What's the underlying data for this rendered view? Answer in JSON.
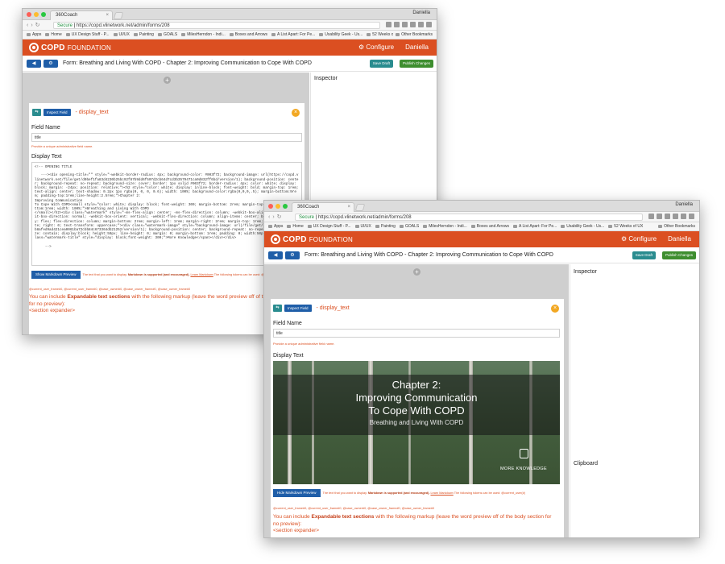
{
  "browser": {
    "tab_title": "360Coach",
    "user": "Daniella",
    "secure_label": "Secure",
    "url": "https://copd.vlinetwork.net/admin/forms/208",
    "bookmarks": [
      "Apps",
      "Home",
      "UX Design Stuff - P...",
      "UI/UX",
      "Painting",
      "GOALS",
      "MilesHerndon - Indi...",
      "Boxes and Arrows",
      "A List Apart: For Pe...",
      "Usability Geek - Us...",
      "52 Weeks of UX"
    ],
    "other_bookmarks": "Other Bookmarks"
  },
  "app": {
    "logo_bold": "COPD",
    "logo_light": "FOUNDATION",
    "nav_configure": "Configure",
    "nav_user": "Daniella"
  },
  "form": {
    "title": "Form: Breathing and Living With COPD - Chapter 2: Improving Communication to Cope With COPD",
    "save_draft": "Save Draft",
    "publish": "Publish Changes",
    "inspector": "Inspector",
    "clipboard": "Clipboard",
    "inspect_field": "Inspect Field",
    "field_type": "- display_text",
    "field_name_label": "Field Name",
    "field_name_value": "title",
    "field_name_help": "Provide a unique administrative field name.",
    "display_text_label": "Display Text",
    "code_text": "<!-- OPENING TITLE\n\n   ---><div opening-title=\"\" style=\"-webkit-border-radius: 4px; background-color: #003f72; background-image: url(https://copd.vlinetwork.net/file/get/d0bef1fa83d4230b25bc92f87b9dd6f507d2cb64d7cd3b3579471ca0d832ff6bd/version/1); background-position: center; background-repeat: no-repeat; background-size: cover; border: 1px solid #003f72; border-radius: 4px; color: white; display: block; margin: -24px; position: relative;\"><h2 style=\"color: white; display: inline-block; font-weight: bold; margin-top: 1rem; text-align: center; text-shadow: 0.2px 1px rgba(0, 0, 0, 0.6); width: 100%; background-color:rgba(0,0,0,.5); margin-bottom:9rem; padding-top:1rem;line-height:2.5rem;\">Chapter 2:\nImproving Communication\nTo Cope With COPD<small style=\"color: white; display: block; font-weight: 300; margin-bottom: 2rem; margin-top: 2px; padding-bottom:1rem; width: 100%;\">Breathing and Living With COPD\n</small></h2><div class=\"watermark\" style=\"-ms-flex-align: center; -ms-flex-direction: column; -webkit-box-align: center; -webkit-box-direction: normal; -webkit-box-orient: vertical; -webkit-flex-direction: column; align-items: center; bottom: 0; display: flex; flex-direction: column; margin-bottom: 2rem; margin-left: 1rem; margin-right: 2rem; margin-top: 1rem; position: absolute; right: 0; text-transform: uppercase;\"><div class=\"watermark-image\" style=\"background-image: url(/file/get/abb0fe4ccbdb4eb00b8afed9ad421cea0061ba72cbb84c673364db21252/version/1); background-position: center; background-repeat: no-repeat; background-size: contain; display:block; height:50px; line-height: 0; margin: 0; margin-bottom: 1rem; padding: 0; width:50px;\"></div><span class=\"watermark-title\" style=\"display: block;font-weight: 300;\">More Knowledge</span></div></div>\n\n     -->",
    "show_preview": "Show Markdown Preview",
    "hide_preview": "Hide Markdown Preview",
    "md_text_1": "The text that you want to display.",
    "md_text_bold": "Markdown is supported (and encouraged).",
    "md_link": "Learn Markdown",
    "md_text_2": "The following tokens can be used: @current_user(#)",
    "tokens": "@current_user_frame#0, @current_user_frame#0, @case_owner#0, @case_owner_frame#0, @case_owner_frame#0",
    "expand_pre": "You can include",
    "expand_bold": "Expandable text sections",
    "expand_post": "with the following markup (leave the word preview off of the body section for no preview):",
    "expand_code": "<section expander>",
    "preview_title_1": "Chapter 2:",
    "preview_title_2": "Improving Communication",
    "preview_title_3": "To Cope With COPD",
    "preview_subtitle": "Breathing and Living With COPD",
    "watermark": "MORE KNOWLEDGE"
  },
  "colors": {
    "brand_orange": "#db4f21",
    "button_blue": "#1f5ea8",
    "draft_teal": "#2a8c8f",
    "publish_green": "#3e8e2f",
    "accent_yellow": "#f2a823"
  }
}
